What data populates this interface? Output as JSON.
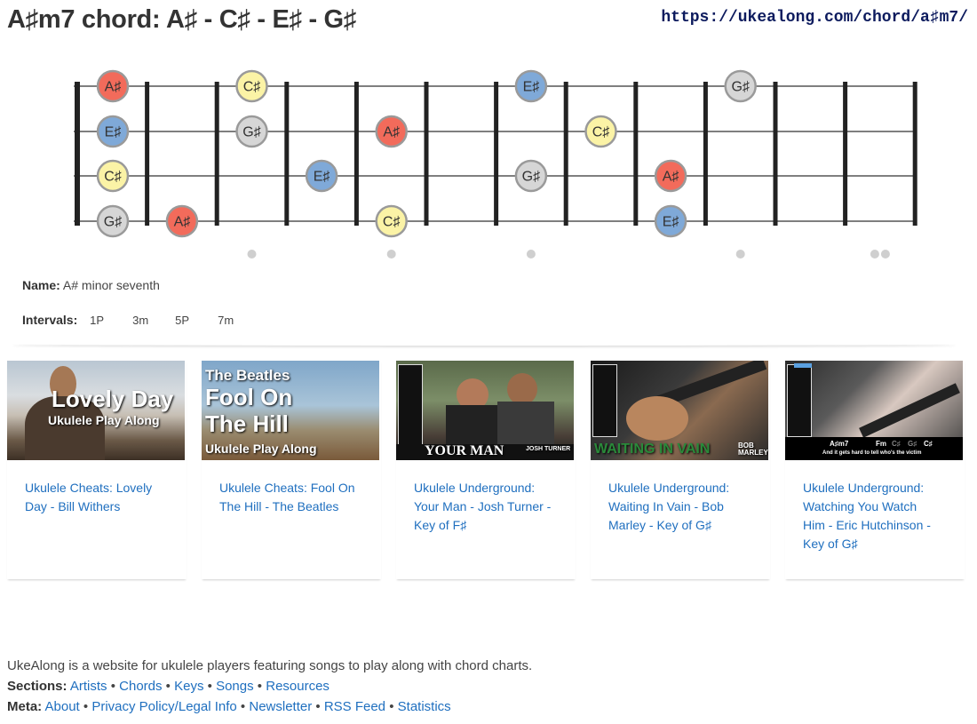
{
  "page": {
    "title": "A♯m7 chord: A♯ - C♯ - E♯ - G♯",
    "url": "https://ukealong.com/chord/a♯m7/"
  },
  "fretboard": {
    "strings": [
      "A",
      "E",
      "C",
      "G"
    ],
    "frets": 12,
    "inlay_frets": [
      3,
      5,
      7,
      10,
      12
    ],
    "note_colors": {
      "A♯": "#f26b5b",
      "C♯": "#fbf3a6",
      "E♯": "#7fa9d8",
      "G♯": "#d6d6d6"
    },
    "notes": [
      {
        "string": 0,
        "fret": 0,
        "label": "A♯"
      },
      {
        "string": 0,
        "fret": 3,
        "label": "C♯"
      },
      {
        "string": 0,
        "fret": 7,
        "label": "E♯"
      },
      {
        "string": 0,
        "fret": 10,
        "label": "G♯"
      },
      {
        "string": 1,
        "fret": 0,
        "label": "E♯"
      },
      {
        "string": 1,
        "fret": 3,
        "label": "G♯"
      },
      {
        "string": 1,
        "fret": 5,
        "label": "A♯"
      },
      {
        "string": 1,
        "fret": 8,
        "label": "C♯"
      },
      {
        "string": 2,
        "fret": 0,
        "label": "C♯"
      },
      {
        "string": 2,
        "fret": 4,
        "label": "E♯"
      },
      {
        "string": 2,
        "fret": 7,
        "label": "G♯"
      },
      {
        "string": 2,
        "fret": 9,
        "label": "A♯"
      },
      {
        "string": 3,
        "fret": 0,
        "label": "G♯"
      },
      {
        "string": 3,
        "fret": 2,
        "label": "A♯"
      },
      {
        "string": 3,
        "fret": 5,
        "label": "C♯"
      },
      {
        "string": 3,
        "fret": 9,
        "label": "E♯"
      }
    ]
  },
  "chord_info": {
    "name_label": "Name:",
    "name_value": "A# minor seventh",
    "intervals_label": "Intervals:",
    "intervals": [
      "1P",
      "3m",
      "5P",
      "7m"
    ]
  },
  "videos": [
    {
      "title": "Ukulele Cheats: Lovely Day - Bill Withers",
      "thumb_text": [
        "Lovely Day",
        "Ukulele Play Along"
      ]
    },
    {
      "title": "Ukulele Cheats: Fool On The Hill - The Beatles",
      "thumb_text": [
        "The Beatles",
        "Fool On",
        "The Hill",
        "Ukulele Play Along"
      ]
    },
    {
      "title": "Ukulele Underground: Your Man - Josh Turner - Key of F♯",
      "thumb_text": [
        "YOUR MAN",
        "JOSH TURNER"
      ]
    },
    {
      "title": "Ukulele Underground: Waiting In Vain - Bob Marley - Key of G♯",
      "thumb_text": [
        "WAITING IN VAIN",
        "BOB MARLEY"
      ]
    },
    {
      "title": "Ukulele Underground: Watching You Watch Him - Eric Hutchinson - Key of G♯",
      "thumb_text": [
        "A♯m7",
        "Fm",
        "C♯",
        "G♯",
        "C♯",
        "And it gets hard to tell who's the victim"
      ]
    }
  ],
  "footer": {
    "description": "UkeAlong is a website for ukulele players featuring songs to play along with chord charts.",
    "sections_label": "Sections:",
    "sections": [
      "Artists",
      "Chords",
      "Keys",
      "Songs",
      "Resources"
    ],
    "meta_label": "Meta:",
    "meta": [
      "About",
      "Privacy Policy/Legal Info",
      "Newsletter",
      "RSS Feed",
      "Statistics"
    ],
    "separator": "•"
  }
}
